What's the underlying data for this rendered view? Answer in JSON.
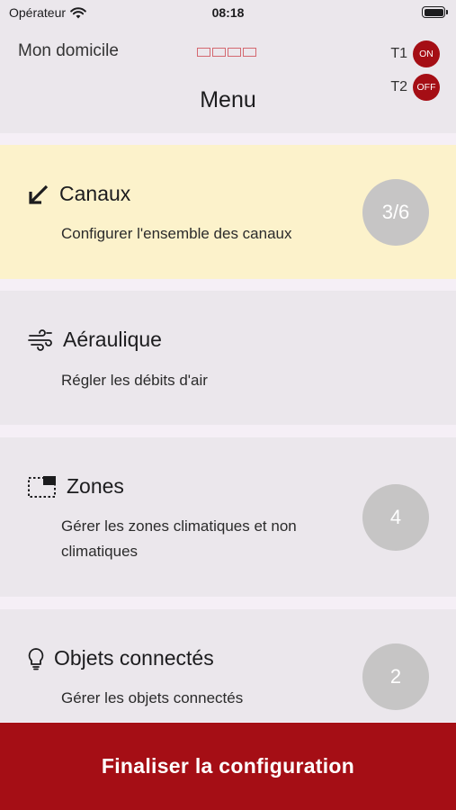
{
  "status_bar": {
    "carrier": "Opérateur",
    "time": "08:18"
  },
  "header": {
    "home_name": "Mon domicile",
    "title": "Menu",
    "thermostats": [
      {
        "label": "T1",
        "state": "ON",
        "color": "#a50e15"
      },
      {
        "label": "T2",
        "state": "OFF",
        "color": "#a50e15"
      }
    ]
  },
  "menu": [
    {
      "title": "Canaux",
      "description": "Configurer l'ensemble des canaux",
      "badge": "3/6",
      "icon": "arrow-down-left-icon",
      "highlight_color": "#fcf2cb"
    },
    {
      "title": "Aéraulique",
      "description": "Régler les débits d'air",
      "badge": "",
      "icon": "air-flow-icon"
    },
    {
      "title": "Zones",
      "description": "Gérer les zones climatiques et non climatiques",
      "badge": "4",
      "icon": "zone-icon"
    },
    {
      "title": "Objets connectés",
      "description": "Gérer les objets connectés",
      "badge": "2",
      "icon": "lightbulb-icon"
    }
  ],
  "footer": {
    "button_label": "Finaliser la configuration",
    "color": "#a50e15"
  }
}
